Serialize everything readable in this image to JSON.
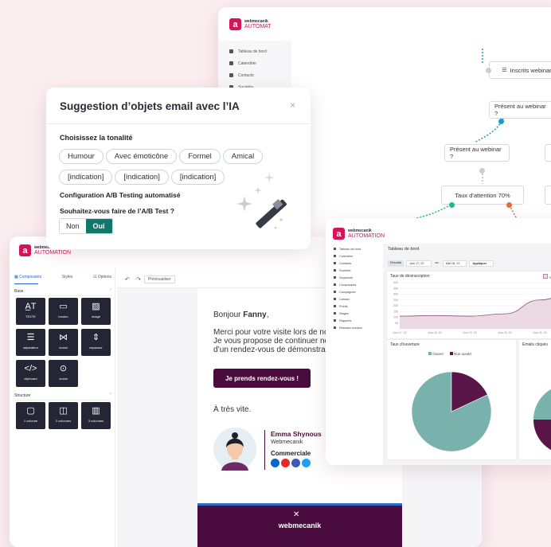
{
  "colors": {
    "brand": "#d4145a",
    "teal": "#12776b",
    "dark": "#242636",
    "plum": "#4a0b3e",
    "piteal": "#79b1ac",
    "piplum": "#5a1648"
  },
  "brand": {
    "small": "webmecanik",
    "big": "AUTOMATION",
    "big_cut": "AUTOMAT"
  },
  "workflow": {
    "nav": [
      "Tableau de bord",
      "Calendrier",
      "Contacts",
      "Sociétés"
    ],
    "nodes": [
      "Inscrits webinar",
      "Présent au webinar ?",
      "Présent au webinar ?",
      "Taux d'attention 70%"
    ]
  },
  "ai_modal": {
    "title": "Suggestion d’objets email avec l’IA",
    "close": "×",
    "tone_label": "Choisissez la tonalité",
    "tones": [
      "Humour",
      "Avec émoticône",
      "Formel",
      "Amical"
    ],
    "indications": [
      "[indication]",
      "[indication]",
      "[indication]"
    ],
    "ab_title": "Configuration A/B Testing automatisé",
    "ab_question": "Souhaitez-vous faire de l’A/B Test ?",
    "no": "Non",
    "yes": "Oui"
  },
  "editor": {
    "tabs": [
      "Composants",
      "Styles",
      "Options"
    ],
    "section_base": "Base",
    "base_tiles": [
      "TEXTE",
      "bouton",
      "image",
      "séparateur",
      "social",
      "espaceur",
      "clipboard",
      "social"
    ],
    "section_struct": "Structure",
    "struct_tiles": [
      "1 colonne",
      "2 colonnes",
      "3 colonnes"
    ],
    "preview_label": "Prévisualiser",
    "greeting_prefix": "Bonjour ",
    "greeting_name": "Fanny",
    "greeting_suffix": ",",
    "body": [
      "Merci pour votre visite lors de no",
      "Je vous propose de continuer no",
      "d’un rendez-vous de démonstrat"
    ],
    "cta": "Je prends rendez-vous !",
    "signoff": "À très vite.",
    "sig_name": "Emma Shynous",
    "sig_company": "Webmecanik",
    "sig_role": "Commerciale",
    "social": [
      "in",
      "yt",
      "f",
      "tw"
    ],
    "footer_brand": "webmecanik"
  },
  "dashboard": {
    "header": "Tableau de bord",
    "filters": [
      "Résultat",
      "Juin 17, 22",
      "au",
      "Mai 18, 22",
      "Appliquer"
    ],
    "nav": [
      "Tableau de bord",
      "Calendrier",
      "Contacts",
      "Sociétés",
      "Segments",
      "Composants",
      "Campagnes",
      "Canaux",
      "Points",
      "Stages",
      "Rapports",
      "Réseaux sociaux"
    ],
    "churn_title": "Taux de désinscription",
    "churn_legend": "To",
    "yticks": [
      "400",
      "350",
      "300",
      "250",
      "200",
      "150",
      "100",
      "50"
    ],
    "xticks": [
      "Juin 17, 22",
      "Juin 18, 22",
      "Juin 19, 22",
      "Juin 20, 22",
      "Juin 21, 22",
      "Juin 17, 22"
    ],
    "open_title": "Taux d'ouverture",
    "open_legend": [
      "Ouvert",
      "Non ouvert"
    ],
    "click_title": "Emails cliqués"
  },
  "chart_data": [
    {
      "type": "area",
      "title": "Taux de désinscription",
      "categories": [
        "Juin 17, 22",
        "Juin 18, 22",
        "Juin 19, 22",
        "Juin 20, 22",
        "Juin 21, 22",
        "Juin 17, 22"
      ],
      "values": [
        110,
        115,
        110,
        130,
        250,
        330
      ],
      "ylim": [
        0,
        400
      ]
    },
    {
      "type": "pie",
      "title": "Taux d'ouverture",
      "series": [
        {
          "name": "Ouvert",
          "values": [
            82
          ]
        },
        {
          "name": "Non ouvert",
          "values": [
            18
          ]
        }
      ]
    }
  ]
}
